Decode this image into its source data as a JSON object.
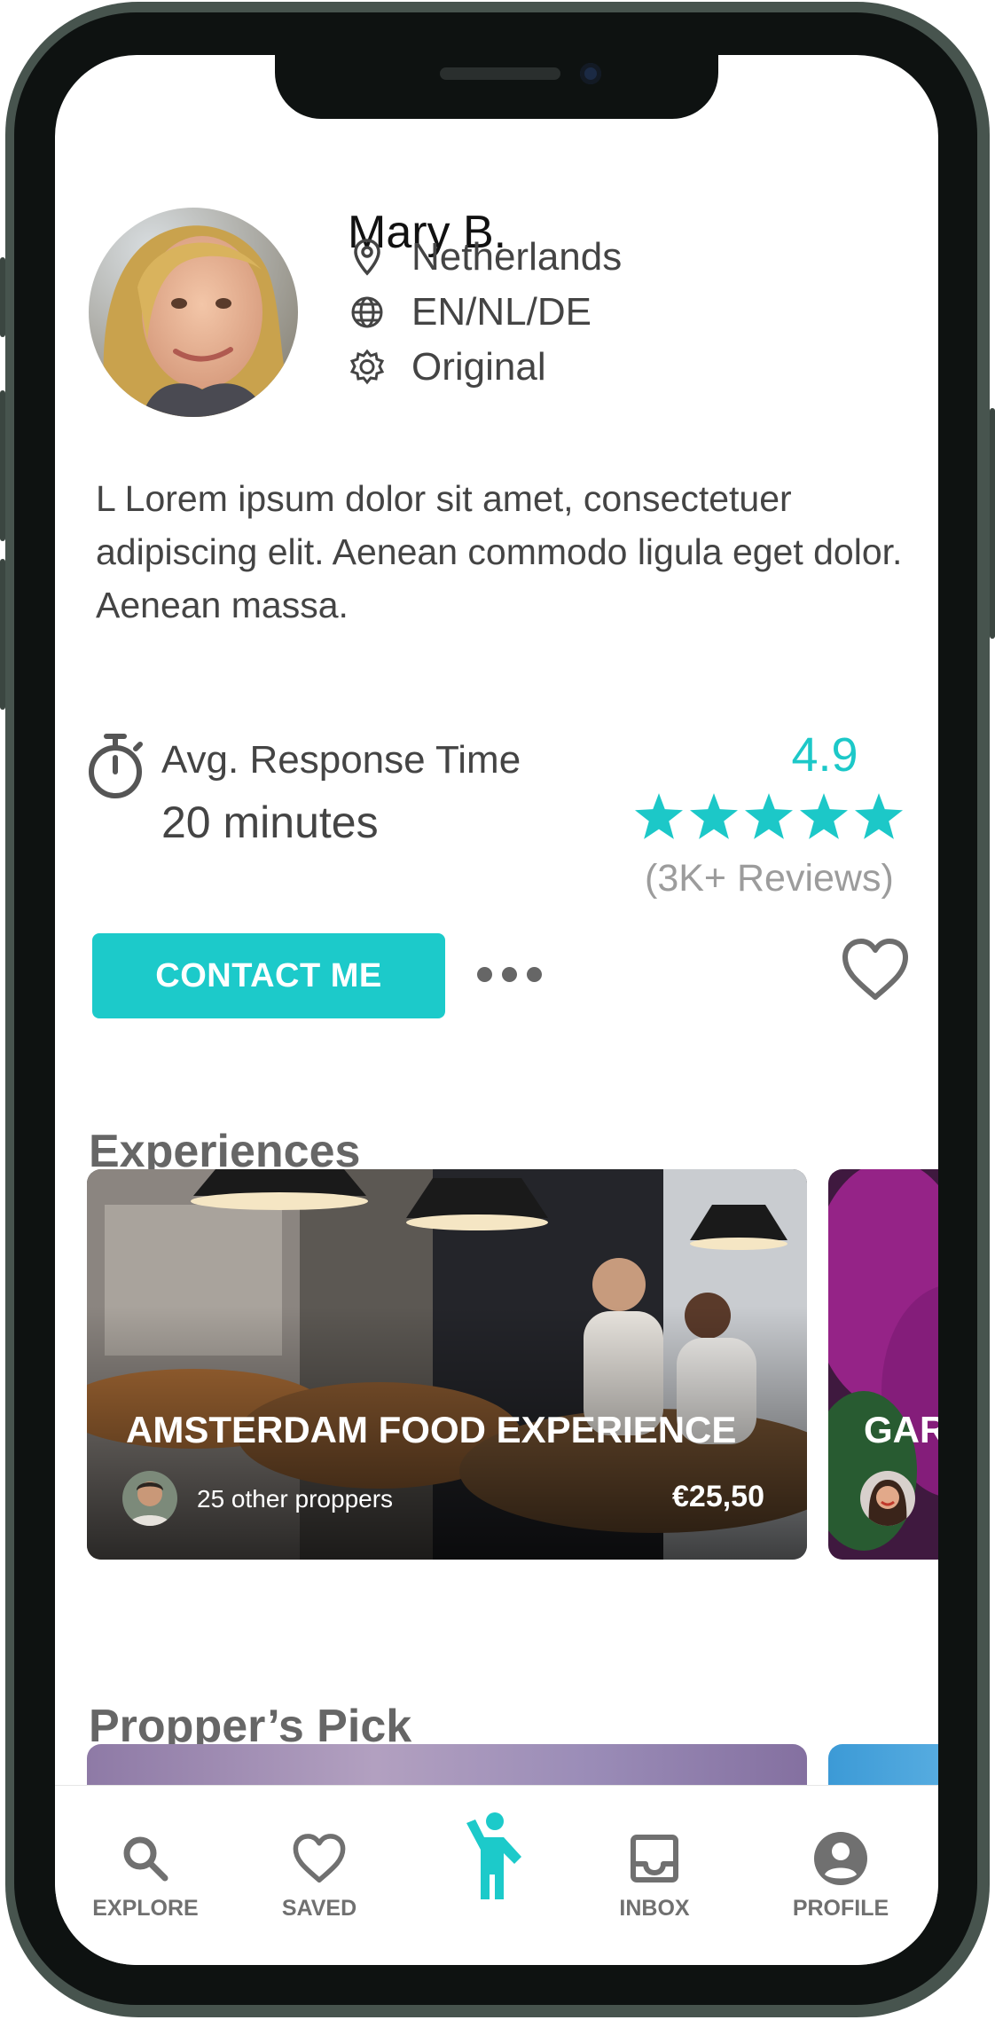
{
  "profile": {
    "name": "Mary B.",
    "location": "Netherlands",
    "languages": "EN/NL/DE",
    "status": "Original",
    "bio": "L Lorem ipsum dolor sit amet, consectetuer adipiscing elit. Aenean commodo ligula eget dolor. Aenean massa."
  },
  "response": {
    "label": "Avg. Response Time",
    "value": "20 minutes"
  },
  "rating": {
    "value": "4.9",
    "stars": 5,
    "reviews": "(3K+ Reviews)"
  },
  "actions": {
    "contact_label": "CONTACT ME"
  },
  "experiences": {
    "title": "Experiences",
    "cards": [
      {
        "title": "AMSTERDAM FOOD EXPERIENCE",
        "proppers": "25 other proppers",
        "price": "€25,50"
      },
      {
        "title": "GAR"
      }
    ]
  },
  "picks": {
    "title": "Propper’s Pick"
  },
  "nav": [
    {
      "label": "EXPLORE",
      "icon": "search-icon"
    },
    {
      "label": "SAVED",
      "icon": "heart-icon"
    },
    {
      "label": "",
      "icon": "waving-person-icon",
      "active": true
    },
    {
      "label": "INBOX",
      "icon": "inbox-icon"
    },
    {
      "label": "PROFILE",
      "icon": "account-circle-icon"
    }
  ],
  "colors": {
    "accent": "#1ccaca",
    "text_dark": "#111111",
    "text_muted": "#707070"
  }
}
